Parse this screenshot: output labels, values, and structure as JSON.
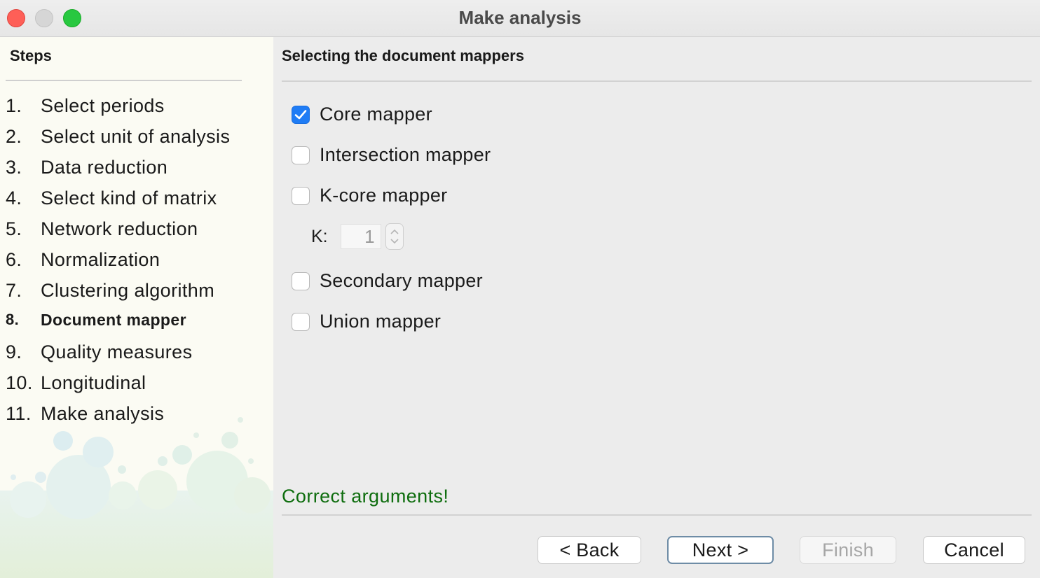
{
  "window": {
    "title": "Make analysis"
  },
  "sidebar": {
    "title": "Steps",
    "steps": [
      {
        "num": "1.",
        "label": "Select periods"
      },
      {
        "num": "2.",
        "label": "Select unit of analysis"
      },
      {
        "num": "3.",
        "label": "Data reduction"
      },
      {
        "num": "4.",
        "label": "Select kind of matrix"
      },
      {
        "num": "5.",
        "label": "Network reduction"
      },
      {
        "num": "6.",
        "label": "Normalization"
      },
      {
        "num": "7.",
        "label": "Clustering algorithm"
      },
      {
        "num": "8.",
        "label": "Document mapper"
      },
      {
        "num": "9.",
        "label": "Quality measures"
      },
      {
        "num": "10.",
        "label": "Longitudinal"
      },
      {
        "num": "11.",
        "label": "Make analysis"
      }
    ],
    "active_step": 8
  },
  "main": {
    "section_title": "Selecting the document mappers",
    "mappers": [
      {
        "label": "Core mapper",
        "checked": true
      },
      {
        "label": "Intersection mapper",
        "checked": false
      },
      {
        "label": "K-core mapper",
        "checked": false
      },
      {
        "label": "Secondary mapper",
        "checked": false
      },
      {
        "label": "Union mapper",
        "checked": false
      }
    ],
    "k_field": {
      "label": "K:",
      "value": "1"
    },
    "status_message": "Correct arguments!",
    "status_color": "#0e6d0e"
  },
  "buttons": {
    "back": "< Back",
    "next": "Next >",
    "finish": "Finish",
    "cancel": "Cancel"
  },
  "colors": {
    "checkbox_checked": "#1f7cf5",
    "close": "#fe5f57",
    "maximize": "#28c840"
  }
}
